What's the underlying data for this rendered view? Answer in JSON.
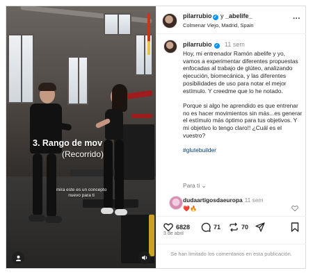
{
  "video": {
    "overlay_title": "3. Rango de mov",
    "overlay_subtitle": "(Recorrido)",
    "caption": "mira este es un concepto nuevo para ti"
  },
  "header": {
    "username": "pilarrubio",
    "separator": "y",
    "collaborator": "_abelife_",
    "location": "Colmenar Viejo, Madrid, Spain"
  },
  "post": {
    "username": "pilarrubio",
    "time": "11 sem",
    "paragraphs": [
      "Hoy, mi entrenador Ramón abelife y yo, vamos a experimentar diferentes propuestas enfocadas al trabajo de glúteo, analizando ejecución, biomecánica, y las diferentes posibilidades de uso para notar el mejor estímulo. Y creedme que lo he notado.",
      "Porque si algo he aprendido es que entrenar no es hacer movimientos sin más...es generar el estímulo más óptimo para tus objetivos. Y mi objetivo lo tengo claro!! ¿Cuál es el vuestro?"
    ],
    "hashtag": "#glutebuilder",
    "translate_label": "Para ti"
  },
  "comment": {
    "username": "dudaartigosdaeuropa",
    "time": "11 sem",
    "text": "❤️🔥"
  },
  "actions": {
    "likes": "6828",
    "comments": "71",
    "reposts": "70"
  },
  "date": "3 de abril",
  "comments_limited": "Se han limitado los comentarios en esta publicación.",
  "colors": {
    "verified": "#0095f6",
    "hashtag": "#00376b",
    "secondary_text": "#8e8e8e"
  }
}
